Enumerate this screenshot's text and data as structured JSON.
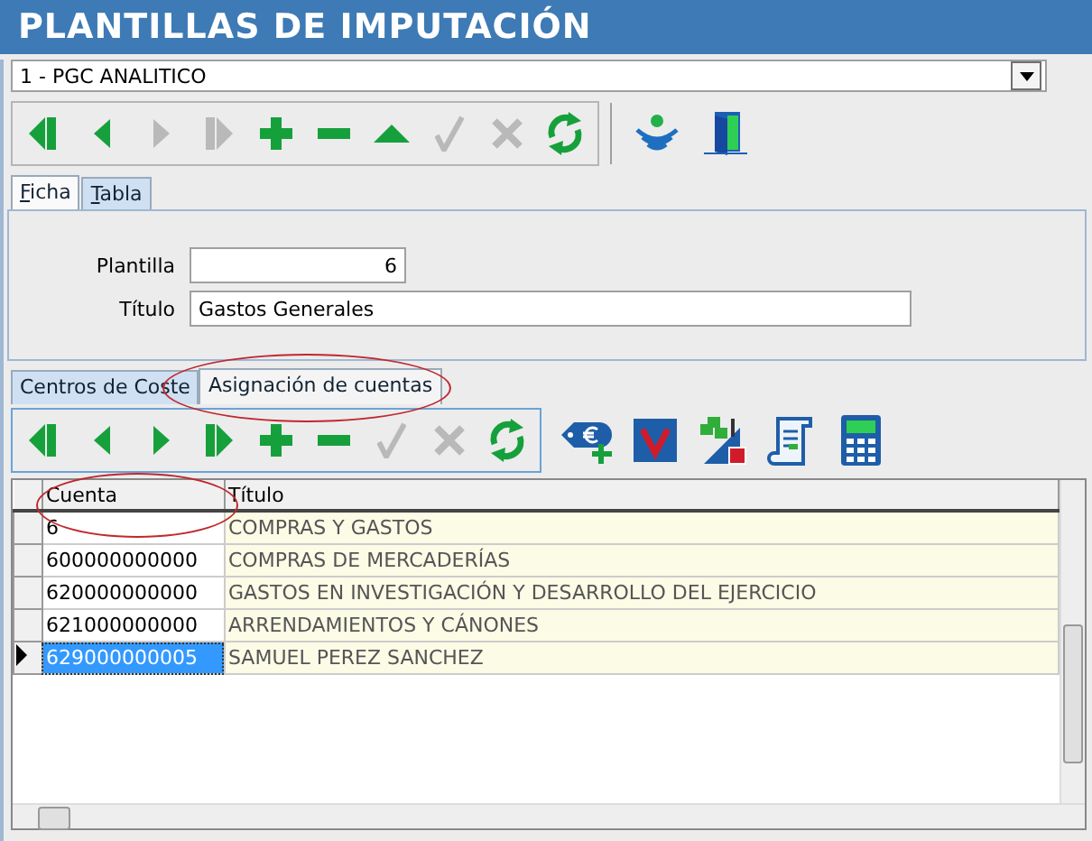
{
  "window": {
    "title": "PLANTILLAS DE IMPUTACIÓN"
  },
  "selector": {
    "value": "1 - PGC ANALITICO"
  },
  "toolbar": [
    {
      "kind": "first",
      "disabled": false
    },
    {
      "kind": "prev",
      "disabled": false
    },
    {
      "kind": "next",
      "disabled": true
    },
    {
      "kind": "last",
      "disabled": true
    },
    {
      "kind": "add",
      "disabled": false
    },
    {
      "kind": "remove",
      "disabled": false
    },
    {
      "kind": "up",
      "disabled": false
    },
    {
      "kind": "confirm",
      "disabled": true
    },
    {
      "kind": "cancel",
      "disabled": true
    },
    {
      "kind": "refresh",
      "disabled": false
    }
  ],
  "toolbar_extra": [
    {
      "kind": "signal"
    },
    {
      "kind": "exit"
    }
  ],
  "tabs": [
    {
      "label": "Ficha",
      "selected": true
    },
    {
      "label": "Tabla",
      "selected": false
    }
  ],
  "form": {
    "fields": [
      {
        "label": "Plantilla",
        "value": "6",
        "kind": "number"
      },
      {
        "label": "Título",
        "value": "Gastos Generales",
        "kind": "text"
      }
    ]
  },
  "detail_tabs": [
    {
      "label": "Centros de Coste",
      "selected": false
    },
    {
      "label": "Asignación de cuentas",
      "selected": true
    }
  ],
  "detail_toolbar": [
    {
      "kind": "first",
      "disabled": false
    },
    {
      "kind": "prev",
      "disabled": false
    },
    {
      "kind": "next",
      "disabled": false
    },
    {
      "kind": "last",
      "disabled": false
    },
    {
      "kind": "add",
      "disabled": false
    },
    {
      "kind": "remove",
      "disabled": false
    },
    {
      "kind": "confirm",
      "disabled": true
    },
    {
      "kind": "cancel",
      "disabled": true
    },
    {
      "kind": "refresh",
      "disabled": false
    }
  ],
  "detail_toolbar_extra": [
    {
      "kind": "euro-tag"
    },
    {
      "kind": "v-logo"
    },
    {
      "kind": "import"
    },
    {
      "kind": "document"
    },
    {
      "kind": "calculator"
    }
  ],
  "table": {
    "columns": [
      "Cuenta",
      "Título"
    ],
    "rows": [
      {
        "cuenta": "6",
        "titulo": "COMPRAS Y GASTOS",
        "selected": false
      },
      {
        "cuenta": "600000000000",
        "titulo": "COMPRAS DE MERCADERÍAS",
        "selected": false
      },
      {
        "cuenta": "620000000000",
        "titulo": "GASTOS EN INVESTIGACIÓN Y DESARROLLO DEL EJERCICIO",
        "selected": false
      },
      {
        "cuenta": "621000000000",
        "titulo": "ARRENDAMIENTOS Y CÁNONES",
        "selected": false
      },
      {
        "cuenta": "629000000005",
        "titulo": "SAMUEL PEREZ SANCHEZ",
        "selected": true
      }
    ]
  }
}
